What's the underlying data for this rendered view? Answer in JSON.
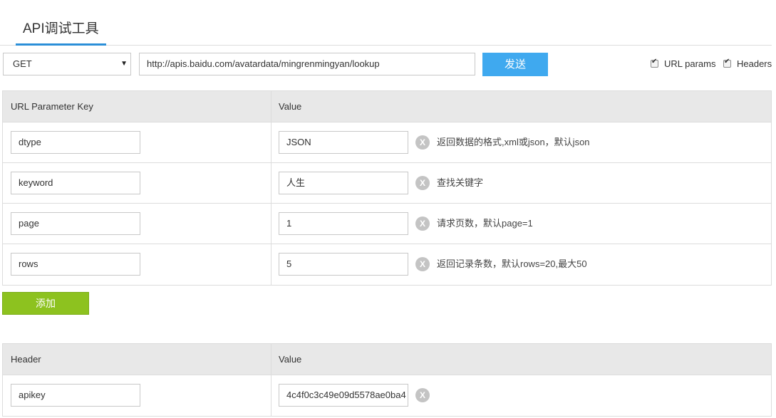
{
  "tab": {
    "title": "API调试工具"
  },
  "request": {
    "method": "GET",
    "url": "http://apis.baidu.com/avatardata/mingrenmingyan/lookup",
    "send_label": "发送"
  },
  "options": [
    {
      "label": "URL params",
      "checked": true
    },
    {
      "label": "Headers",
      "checked": true
    }
  ],
  "params_table": {
    "key_header": "URL Parameter Key",
    "value_header": "Value",
    "rows": [
      {
        "key": "dtype",
        "value": "JSON",
        "desc": "返回数据的格式,xml或json，默认json"
      },
      {
        "key": "keyword",
        "value": "人生",
        "desc": "查找关键字"
      },
      {
        "key": "page",
        "value": "1",
        "desc": "请求页数，默认page=1"
      },
      {
        "key": "rows",
        "value": "5",
        "desc": "返回记录条数，默认rows=20,最大50"
      }
    ]
  },
  "add_label": "添加",
  "headers_table": {
    "key_header": "Header",
    "value_header": "Value",
    "rows": [
      {
        "key": "apikey",
        "value": "4c4f0c3c49e09d5578ae0ba4"
      }
    ]
  },
  "icons": {
    "remove": "close-circle-icon",
    "dropdown": "caret-down-icon",
    "check": "checkmark-icon"
  },
  "colors": {
    "accent": "#2b8fd8",
    "send": "#3fa9ef",
    "add": "#8dc21f",
    "remove": "#c4c4c4"
  }
}
